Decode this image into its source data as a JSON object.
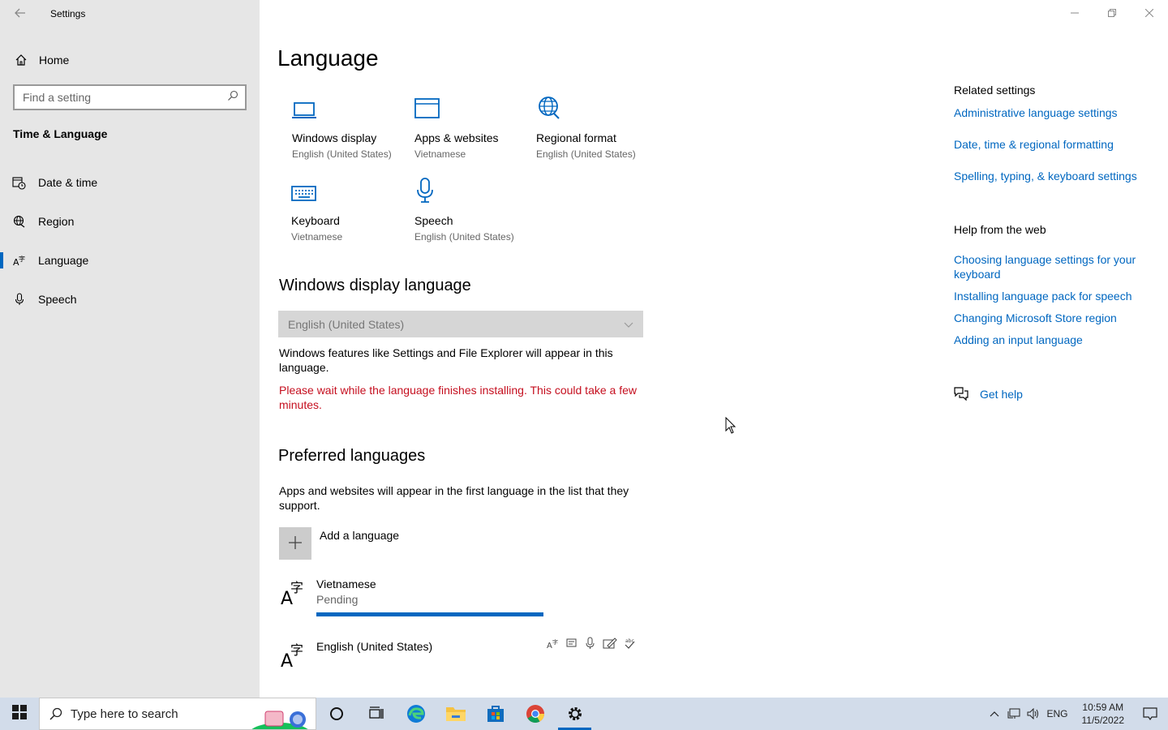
{
  "window": {
    "title": "Settings"
  },
  "sidebar": {
    "home_label": "Home",
    "search_placeholder": "Find a setting",
    "category": "Time & Language",
    "items": [
      {
        "label": "Date & time",
        "icon": "calendar-clock-icon"
      },
      {
        "label": "Region",
        "icon": "globe-icon"
      },
      {
        "label": "Language",
        "icon": "language-icon",
        "active": true
      },
      {
        "label": "Speech",
        "icon": "microphone-icon"
      }
    ]
  },
  "main": {
    "title": "Language",
    "tiles": [
      {
        "name": "Windows display",
        "sub": "English (United States)",
        "icon": "laptop-icon"
      },
      {
        "name": "Apps & websites",
        "sub": "Vietnamese",
        "icon": "window-icon"
      },
      {
        "name": "Regional format",
        "sub": "English (United States)",
        "icon": "regional-format-icon"
      },
      {
        "name": "Keyboard",
        "sub": "Vietnamese",
        "icon": "keyboard-icon"
      },
      {
        "name": "Speech",
        "sub": "English (United States)",
        "icon": "microphone-icon"
      }
    ],
    "display_language": {
      "heading": "Windows display language",
      "selected": "English (United States)",
      "description": "Windows features like Settings and File Explorer will appear in this language.",
      "warning": "Please wait while the language finishes installing. This could take a few minutes."
    },
    "preferred": {
      "heading": "Preferred languages",
      "description": "Apps and websites will appear in the first language in the list that they support.",
      "add_label": "Add a language",
      "languages": [
        {
          "name": "Vietnamese",
          "status": "Pending",
          "progress": 1.0
        },
        {
          "name": "English (United States)"
        }
      ]
    }
  },
  "related": {
    "heading": "Related settings",
    "links": [
      "Administrative language settings",
      "Date, time & regional formatting",
      "Spelling, typing, & keyboard settings"
    ]
  },
  "help": {
    "heading": "Help from the web",
    "links": [
      "Choosing language settings for your keyboard",
      "Installing language pack for speech",
      "Changing Microsoft Store region",
      "Adding an input language"
    ],
    "get_help": "Get help"
  },
  "taskbar": {
    "search_placeholder": "Type here to search",
    "lang": "ENG",
    "time": "10:59 AM",
    "date": "11/5/2022"
  },
  "colors": {
    "accent": "#0067c0",
    "warning": "#c50f1f",
    "sidebar_bg": "#e6e6e6",
    "taskbar_bg": "#d2dcea"
  }
}
